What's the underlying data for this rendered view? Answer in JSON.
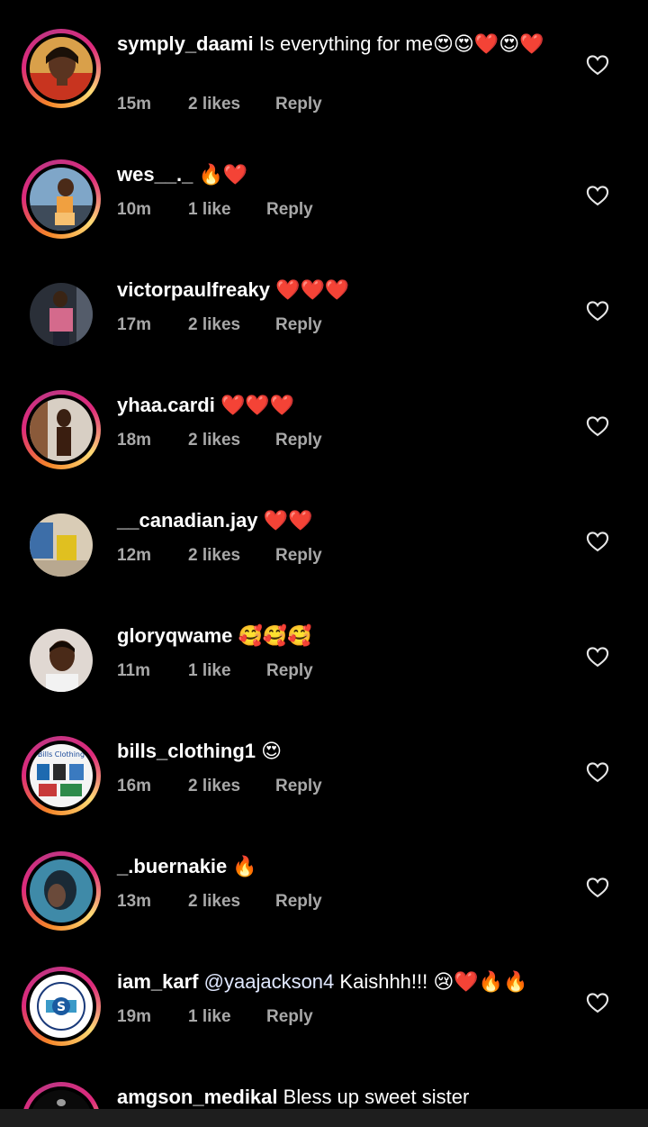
{
  "colors": {
    "background": "#000000",
    "meta_text": "#a8a8a8",
    "story_ring_start": "#f58529",
    "story_ring_end": "#dd2a7b",
    "heart_red": "#e0182d"
  },
  "comments": [
    {
      "username": "symply_daami",
      "text": "Is everything for me",
      "emoji": "😍😍❤️😍❤️",
      "time": "15m",
      "likes": "2 likes",
      "reply": "Reply",
      "icon": "heart-outline-icon"
    },
    {
      "username": "wes__._",
      "text": "",
      "emoji": "🔥❤️",
      "time": "10m",
      "likes": "1 like",
      "reply": "Reply",
      "icon": "heart-outline-icon"
    },
    {
      "username": "victorpaulfreaky",
      "text": "",
      "emoji": "❤️❤️❤️",
      "time": "17m",
      "likes": "2 likes",
      "reply": "Reply",
      "icon": "heart-outline-icon"
    },
    {
      "username": "yhaa.cardi",
      "text": "",
      "emoji": "❤️❤️❤️",
      "time": "18m",
      "likes": "2 likes",
      "reply": "Reply",
      "icon": "heart-outline-icon"
    },
    {
      "username": "__canadian.jay",
      "text": "",
      "emoji": "❤️❤️",
      "time": "12m",
      "likes": "2 likes",
      "reply": "Reply",
      "icon": "heart-outline-icon"
    },
    {
      "username": "gloryqwame",
      "text": "",
      "emoji": "🥰🥰🥰",
      "time": "11m",
      "likes": "1 like",
      "reply": "Reply",
      "icon": "heart-outline-icon"
    },
    {
      "username": "bills_clothing1",
      "text": "",
      "emoji": "😍",
      "time": "16m",
      "likes": "2 likes",
      "reply": "Reply",
      "icon": "heart-outline-icon"
    },
    {
      "username": "_.buernakie",
      "text": "",
      "emoji": "🔥",
      "time": "13m",
      "likes": "2 likes",
      "reply": "Reply",
      "icon": "heart-outline-icon"
    },
    {
      "username": "iam_karf",
      "mention": "@yaajackson4",
      "text": "Kaishhh!!!",
      "emoji": "😢❤️🔥🔥",
      "time": "19m",
      "likes": "1 like",
      "reply": "Reply",
      "icon": "heart-outline-icon"
    },
    {
      "username": "amgson_medikal",
      "text": "Bless up sweet sister",
      "emoji": ""
    }
  ],
  "avatar_logos": {
    "bills": "Bills Clothing",
    "karf_letter": "S"
  }
}
